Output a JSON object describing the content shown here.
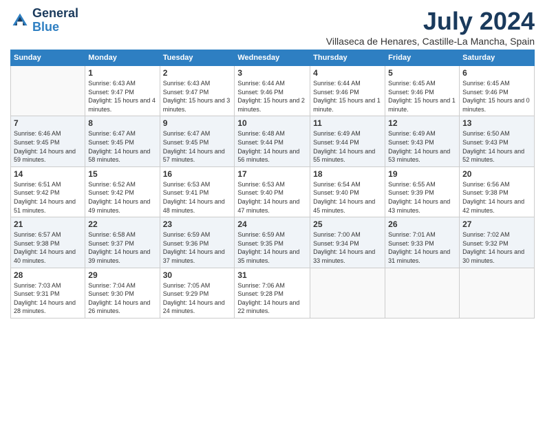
{
  "logo": {
    "line1": "General",
    "line2": "Blue"
  },
  "title": "July 2024",
  "subtitle": "Villaseca de Henares, Castille-La Mancha, Spain",
  "weekdays": [
    "Sunday",
    "Monday",
    "Tuesday",
    "Wednesday",
    "Thursday",
    "Friday",
    "Saturday"
  ],
  "weeks": [
    [
      {
        "day": "",
        "sunrise": "",
        "sunset": "",
        "daylight": ""
      },
      {
        "day": "1",
        "sunrise": "Sunrise: 6:43 AM",
        "sunset": "Sunset: 9:47 PM",
        "daylight": "Daylight: 15 hours and 4 minutes."
      },
      {
        "day": "2",
        "sunrise": "Sunrise: 6:43 AM",
        "sunset": "Sunset: 9:47 PM",
        "daylight": "Daylight: 15 hours and 3 minutes."
      },
      {
        "day": "3",
        "sunrise": "Sunrise: 6:44 AM",
        "sunset": "Sunset: 9:46 PM",
        "daylight": "Daylight: 15 hours and 2 minutes."
      },
      {
        "day": "4",
        "sunrise": "Sunrise: 6:44 AM",
        "sunset": "Sunset: 9:46 PM",
        "daylight": "Daylight: 15 hours and 1 minute."
      },
      {
        "day": "5",
        "sunrise": "Sunrise: 6:45 AM",
        "sunset": "Sunset: 9:46 PM",
        "daylight": "Daylight: 15 hours and 1 minute."
      },
      {
        "day": "6",
        "sunrise": "Sunrise: 6:45 AM",
        "sunset": "Sunset: 9:46 PM",
        "daylight": "Daylight: 15 hours and 0 minutes."
      }
    ],
    [
      {
        "day": "7",
        "sunrise": "Sunrise: 6:46 AM",
        "sunset": "Sunset: 9:45 PM",
        "daylight": "Daylight: 14 hours and 59 minutes."
      },
      {
        "day": "8",
        "sunrise": "Sunrise: 6:47 AM",
        "sunset": "Sunset: 9:45 PM",
        "daylight": "Daylight: 14 hours and 58 minutes."
      },
      {
        "day": "9",
        "sunrise": "Sunrise: 6:47 AM",
        "sunset": "Sunset: 9:45 PM",
        "daylight": "Daylight: 14 hours and 57 minutes."
      },
      {
        "day": "10",
        "sunrise": "Sunrise: 6:48 AM",
        "sunset": "Sunset: 9:44 PM",
        "daylight": "Daylight: 14 hours and 56 minutes."
      },
      {
        "day": "11",
        "sunrise": "Sunrise: 6:49 AM",
        "sunset": "Sunset: 9:44 PM",
        "daylight": "Daylight: 14 hours and 55 minutes."
      },
      {
        "day": "12",
        "sunrise": "Sunrise: 6:49 AM",
        "sunset": "Sunset: 9:43 PM",
        "daylight": "Daylight: 14 hours and 53 minutes."
      },
      {
        "day": "13",
        "sunrise": "Sunrise: 6:50 AM",
        "sunset": "Sunset: 9:43 PM",
        "daylight": "Daylight: 14 hours and 52 minutes."
      }
    ],
    [
      {
        "day": "14",
        "sunrise": "Sunrise: 6:51 AM",
        "sunset": "Sunset: 9:42 PM",
        "daylight": "Daylight: 14 hours and 51 minutes."
      },
      {
        "day": "15",
        "sunrise": "Sunrise: 6:52 AM",
        "sunset": "Sunset: 9:42 PM",
        "daylight": "Daylight: 14 hours and 49 minutes."
      },
      {
        "day": "16",
        "sunrise": "Sunrise: 6:53 AM",
        "sunset": "Sunset: 9:41 PM",
        "daylight": "Daylight: 14 hours and 48 minutes."
      },
      {
        "day": "17",
        "sunrise": "Sunrise: 6:53 AM",
        "sunset": "Sunset: 9:40 PM",
        "daylight": "Daylight: 14 hours and 47 minutes."
      },
      {
        "day": "18",
        "sunrise": "Sunrise: 6:54 AM",
        "sunset": "Sunset: 9:40 PM",
        "daylight": "Daylight: 14 hours and 45 minutes."
      },
      {
        "day": "19",
        "sunrise": "Sunrise: 6:55 AM",
        "sunset": "Sunset: 9:39 PM",
        "daylight": "Daylight: 14 hours and 43 minutes."
      },
      {
        "day": "20",
        "sunrise": "Sunrise: 6:56 AM",
        "sunset": "Sunset: 9:38 PM",
        "daylight": "Daylight: 14 hours and 42 minutes."
      }
    ],
    [
      {
        "day": "21",
        "sunrise": "Sunrise: 6:57 AM",
        "sunset": "Sunset: 9:38 PM",
        "daylight": "Daylight: 14 hours and 40 minutes."
      },
      {
        "day": "22",
        "sunrise": "Sunrise: 6:58 AM",
        "sunset": "Sunset: 9:37 PM",
        "daylight": "Daylight: 14 hours and 39 minutes."
      },
      {
        "day": "23",
        "sunrise": "Sunrise: 6:59 AM",
        "sunset": "Sunset: 9:36 PM",
        "daylight": "Daylight: 14 hours and 37 minutes."
      },
      {
        "day": "24",
        "sunrise": "Sunrise: 6:59 AM",
        "sunset": "Sunset: 9:35 PM",
        "daylight": "Daylight: 14 hours and 35 minutes."
      },
      {
        "day": "25",
        "sunrise": "Sunrise: 7:00 AM",
        "sunset": "Sunset: 9:34 PM",
        "daylight": "Daylight: 14 hours and 33 minutes."
      },
      {
        "day": "26",
        "sunrise": "Sunrise: 7:01 AM",
        "sunset": "Sunset: 9:33 PM",
        "daylight": "Daylight: 14 hours and 31 minutes."
      },
      {
        "day": "27",
        "sunrise": "Sunrise: 7:02 AM",
        "sunset": "Sunset: 9:32 PM",
        "daylight": "Daylight: 14 hours and 30 minutes."
      }
    ],
    [
      {
        "day": "28",
        "sunrise": "Sunrise: 7:03 AM",
        "sunset": "Sunset: 9:31 PM",
        "daylight": "Daylight: 14 hours and 28 minutes."
      },
      {
        "day": "29",
        "sunrise": "Sunrise: 7:04 AM",
        "sunset": "Sunset: 9:30 PM",
        "daylight": "Daylight: 14 hours and 26 minutes."
      },
      {
        "day": "30",
        "sunrise": "Sunrise: 7:05 AM",
        "sunset": "Sunset: 9:29 PM",
        "daylight": "Daylight: 14 hours and 24 minutes."
      },
      {
        "day": "31",
        "sunrise": "Sunrise: 7:06 AM",
        "sunset": "Sunset: 9:28 PM",
        "daylight": "Daylight: 14 hours and 22 minutes."
      },
      {
        "day": "",
        "sunrise": "",
        "sunset": "",
        "daylight": ""
      },
      {
        "day": "",
        "sunrise": "",
        "sunset": "",
        "daylight": ""
      },
      {
        "day": "",
        "sunrise": "",
        "sunset": "",
        "daylight": ""
      }
    ]
  ]
}
